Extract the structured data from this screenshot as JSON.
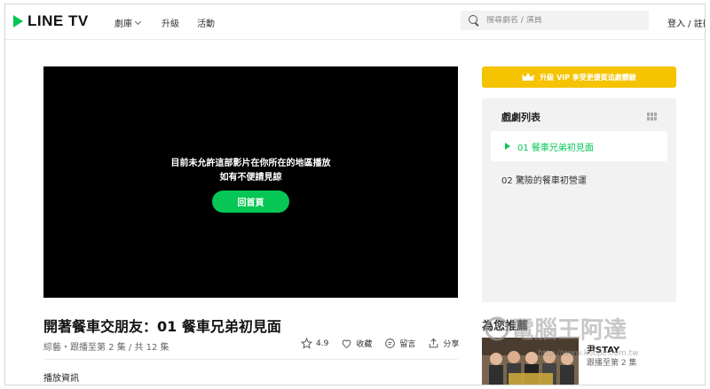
{
  "header": {
    "logo_text": "LINE TV",
    "nav": [
      {
        "label": "劇庫"
      },
      {
        "label": "升級"
      },
      {
        "label": "活動"
      }
    ],
    "search_placeholder": "搜尋劇名 / 演員",
    "login_label": "登入 / 註冊"
  },
  "player": {
    "message_line1": "目前未允許這部影片在你所在的地區播放",
    "message_line2": "如有不便請見諒",
    "home_button": "回首頁"
  },
  "episode_info": {
    "title": "開著餐車交朋友：01 餐車兄弟初見面",
    "subtitle": "綜藝・跟播至第 2 集 / 共 12 集",
    "rating": "4.9",
    "collect_label": "收藏",
    "comment_label": "留言",
    "share_label": "分享",
    "play_info_label": "播放資訊"
  },
  "sidebar": {
    "vip_banner": "升級 VIP 享受更優質追劇體驗",
    "episode_list_title": "戲劇列表",
    "episodes": [
      {
        "label": "01 餐車兄弟初見面",
        "active": true
      },
      {
        "label": "02 驚險的餐車初營運",
        "active": false
      }
    ],
    "recommend_title": "為您推薦",
    "recommend": {
      "name": "尹STAY",
      "status": "跟播至第 2 集"
    }
  },
  "watermark": {
    "text": "電腦王阿達",
    "url": "http://www.kocpc.com.tw"
  },
  "colors": {
    "brand_green": "#06c755",
    "vip_yellow": "#f6c300"
  }
}
